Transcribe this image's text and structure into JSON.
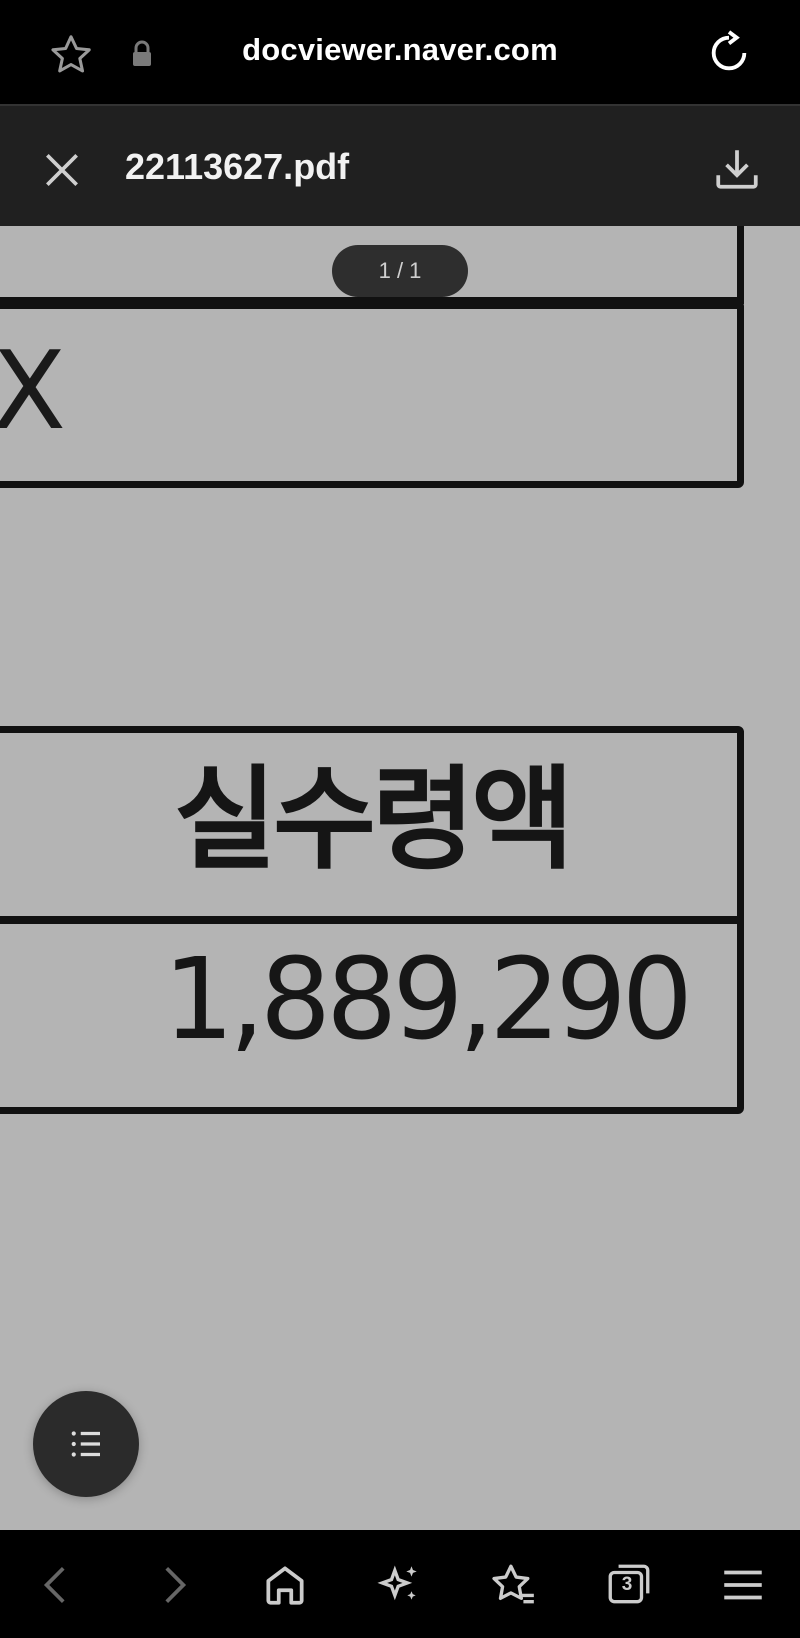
{
  "browser": {
    "url": "docviewer.naver.com",
    "icons": [
      "star-icon",
      "lock-icon",
      "reload-icon"
    ]
  },
  "doc_header": {
    "title": "22113627.pdf",
    "icons": [
      "close-icon",
      "download-icon"
    ]
  },
  "viewer": {
    "page_indicator": "1 / 1",
    "cell_mark": "X",
    "net_pay_label": "실수령액",
    "net_pay_amount": "1,889,290"
  },
  "fab": {
    "icon": "list-icon"
  },
  "bottom_nav": {
    "icons": [
      "back-icon",
      "forward-icon",
      "home-icon",
      "sparkle-icon",
      "bookmarks-icon",
      "tabs-icon",
      "menu-icon"
    ],
    "tab_count": "3"
  }
}
